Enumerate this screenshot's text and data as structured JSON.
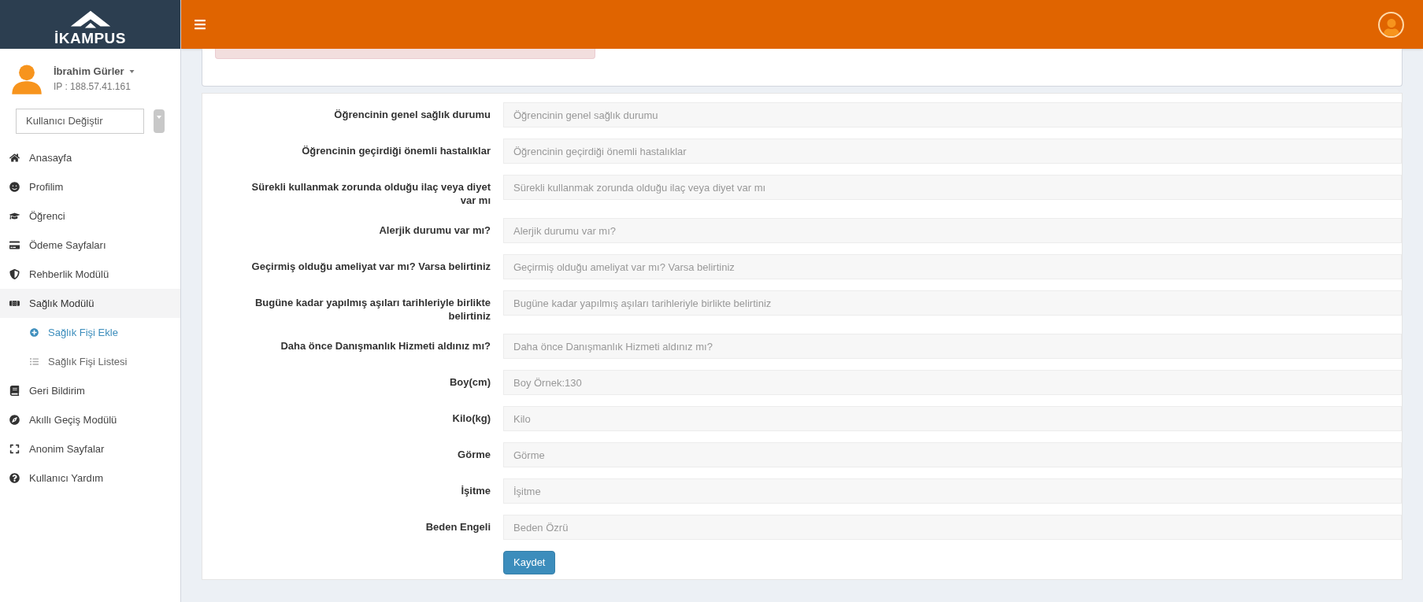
{
  "sidebar": {
    "brand": "İKAMPUS",
    "user": {
      "name": "İbrahim Gürler",
      "ip": "IP : 188.57.41.161"
    },
    "switch_user": {
      "value": "Kullanıcı Değiştir"
    },
    "items": [
      {
        "label": "Anasayfa",
        "selected": false
      },
      {
        "label": "Profilim",
        "selected": false
      },
      {
        "label": "Öğrenci",
        "selected": false
      },
      {
        "label": "Ödeme Sayfaları",
        "selected": false
      },
      {
        "label": "Rehberlik Modülü",
        "selected": false
      },
      {
        "label": "Sağlık Modülü",
        "selected": true,
        "expanded": true,
        "children": [
          {
            "label": "Sağlık Fişi Ekle",
            "selected": true
          },
          {
            "label": "Sağlık Fişi Listesi",
            "selected": false
          }
        ]
      },
      {
        "label": "Geri Bildirim",
        "selected": false
      },
      {
        "label": "Akıllı Geçiş Modülü",
        "selected": false
      },
      {
        "label": "Anonim Sayfalar",
        "selected": false
      },
      {
        "label": "Kullanıcı Yardım",
        "selected": false
      }
    ]
  },
  "form": {
    "fields": [
      {
        "label": "Öğrencinin genel sağlık durumu",
        "placeholder": "Öğrencinin genel sağlık durumu"
      },
      {
        "label": "Öğrencinin geçirdiği önemli hastalıklar",
        "placeholder": "Öğrencinin geçirdiği önemli hastalıklar"
      },
      {
        "label": "Sürekli kullanmak zorunda olduğu ilaç veya diyet var mı",
        "placeholder": "Sürekli kullanmak zorunda olduğu ilaç veya diyet var mı"
      },
      {
        "label": "Alerjik durumu var mı?",
        "placeholder": "Alerjik durumu var mı?"
      },
      {
        "label": "Geçirmiş olduğu ameliyat var mı? Varsa belirtiniz",
        "placeholder": "Geçirmiş olduğu ameliyat var mı? Varsa belirtiniz"
      },
      {
        "label": "Bugüne kadar yapılmış aşıları tarihleriyle birlikte belirtiniz",
        "placeholder": "Bugüne kadar yapılmış aşıları tarihleriyle birlikte belirtiniz"
      },
      {
        "label": "Daha önce Danışmanlık Hizmeti aldınız mı?",
        "placeholder": "Daha önce Danışmanlık Hizmeti aldınız mı?"
      },
      {
        "label": "Boy(cm)",
        "placeholder": "Boy Örnek:130"
      },
      {
        "label": "Kilo(kg)",
        "placeholder": "Kilo"
      },
      {
        "label": "Görme",
        "placeholder": "Görme"
      },
      {
        "label": "İşitme",
        "placeholder": "İşitme"
      },
      {
        "label": "Beden Engeli",
        "placeholder": "Beden Özrü"
      }
    ],
    "submit": "Kaydet"
  }
}
